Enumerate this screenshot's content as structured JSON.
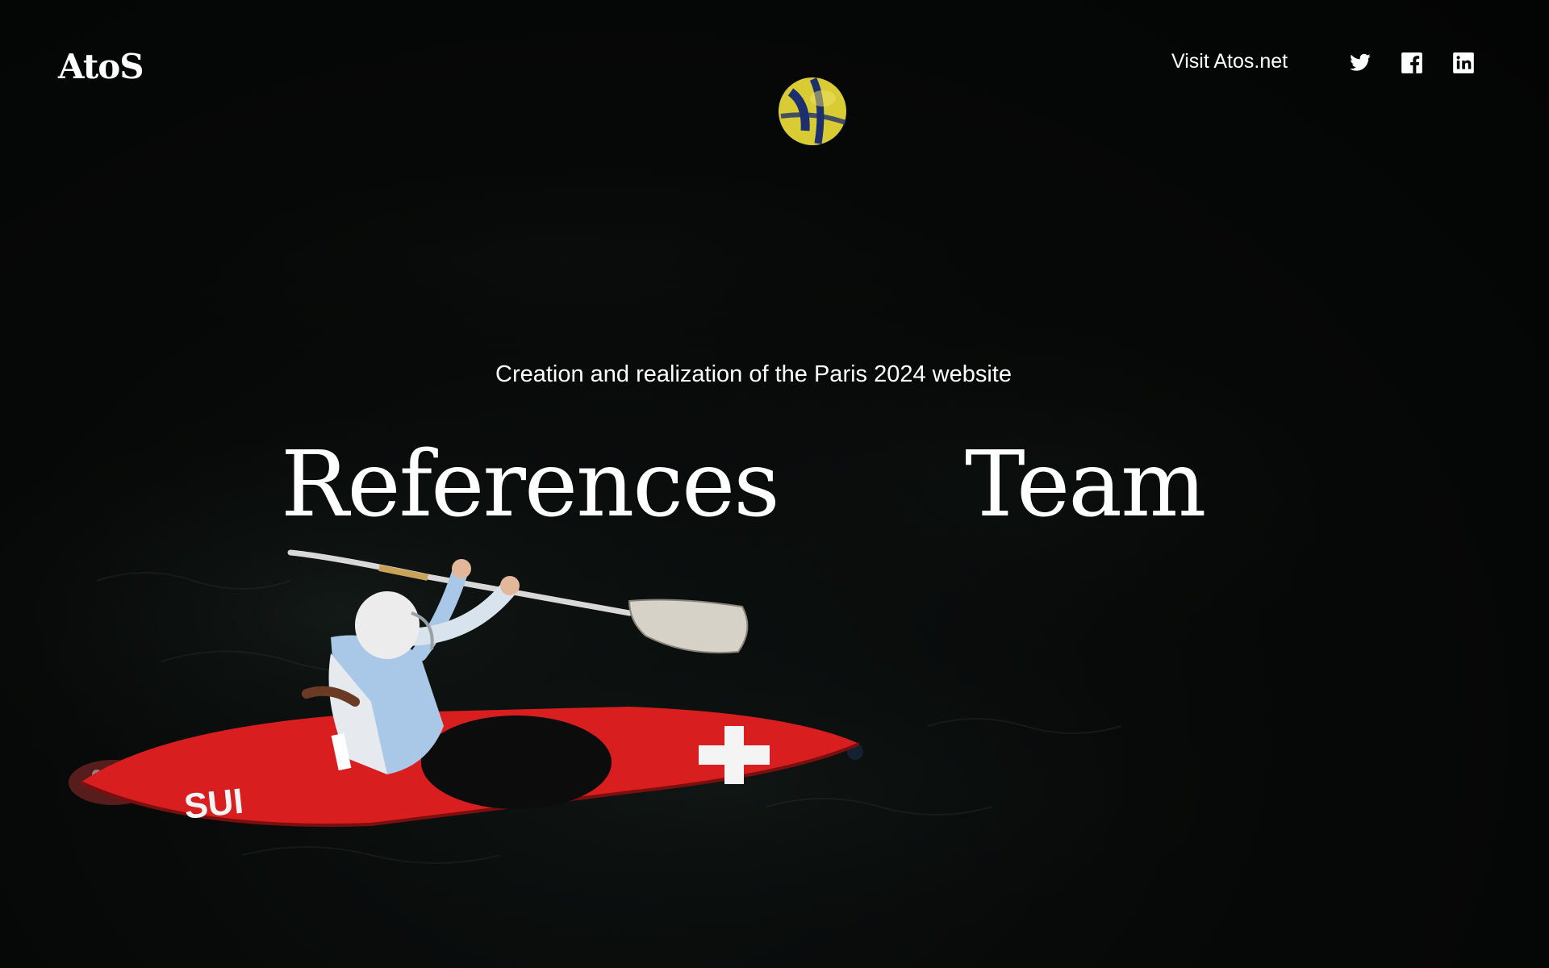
{
  "header": {
    "logo_text": "AtoS",
    "visit_link": "Visit Atos.net",
    "social": [
      {
        "name": "twitter",
        "icon": "twitter-icon"
      },
      {
        "name": "facebook",
        "icon": "facebook-icon"
      },
      {
        "name": "linkedin",
        "icon": "linkedin-icon"
      }
    ]
  },
  "hero": {
    "subtitle": "Creation and realization of the Paris 2024 website",
    "nav": [
      {
        "label": "References"
      },
      {
        "label": "Team"
      }
    ]
  },
  "photo": {
    "kayak_text": "SUI",
    "colors": {
      "kayak": "#d81e1e",
      "ball_yellow": "#e2d436",
      "ball_blue": "#1c2f6e",
      "water": "#070908"
    }
  }
}
